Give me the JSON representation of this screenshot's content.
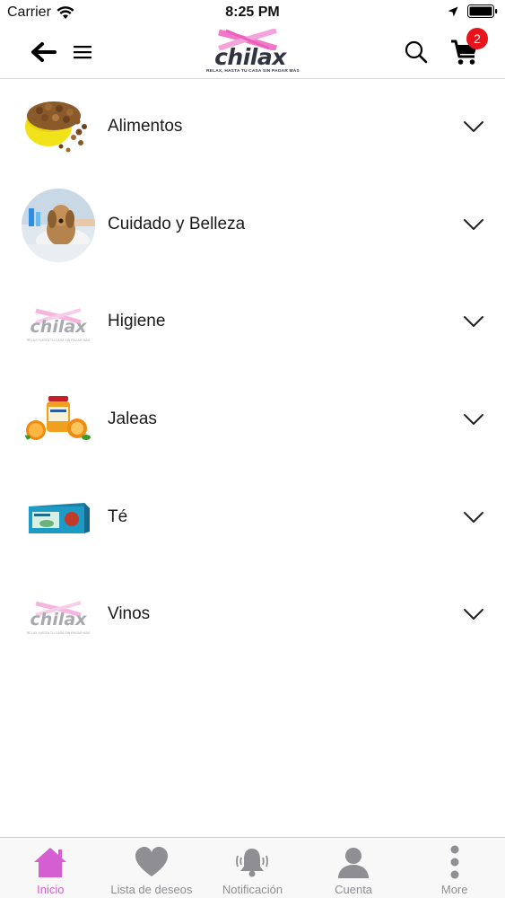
{
  "status_bar": {
    "carrier": "Carrier",
    "time": "8:25 PM"
  },
  "header": {
    "logo": {
      "name": "chilax",
      "tagline": "RELAX, HASTA TU CASA SIN PAGAR MÁS"
    },
    "cart_count": "2",
    "icons": [
      "back-arrow-icon",
      "hamburger-menu-icon",
      "search-icon",
      "cart-icon"
    ]
  },
  "categories": [
    {
      "label": "Alimentos",
      "thumb": "dog-food-bowl"
    },
    {
      "label": "Cuidado y Belleza",
      "thumb": "dog-bath"
    },
    {
      "label": "Higiene",
      "thumb": "chilax-logo"
    },
    {
      "label": "Jaleas",
      "thumb": "orange-jam-jar"
    },
    {
      "label": "Té",
      "thumb": "tea-box"
    },
    {
      "label": "Vinos",
      "thumb": "chilax-logo"
    }
  ],
  "tab_bar": {
    "tabs": [
      {
        "label": "Inicio",
        "icon": "home-icon",
        "active": true
      },
      {
        "label": "Lista de deseos",
        "icon": "heart-icon",
        "active": false
      },
      {
        "label": "Notificación",
        "icon": "bell-icon",
        "active": false
      },
      {
        "label": "Cuenta",
        "icon": "person-icon",
        "active": false
      },
      {
        "label": "More",
        "icon": "more-vertical-icon",
        "active": false
      }
    ]
  },
  "colors": {
    "active_tab": "#d55fd0",
    "inactive_tab": "#8e8e93",
    "badge": "#e8131b",
    "logo_pink": "#f078c8",
    "logo_dark": "#2f3440"
  }
}
